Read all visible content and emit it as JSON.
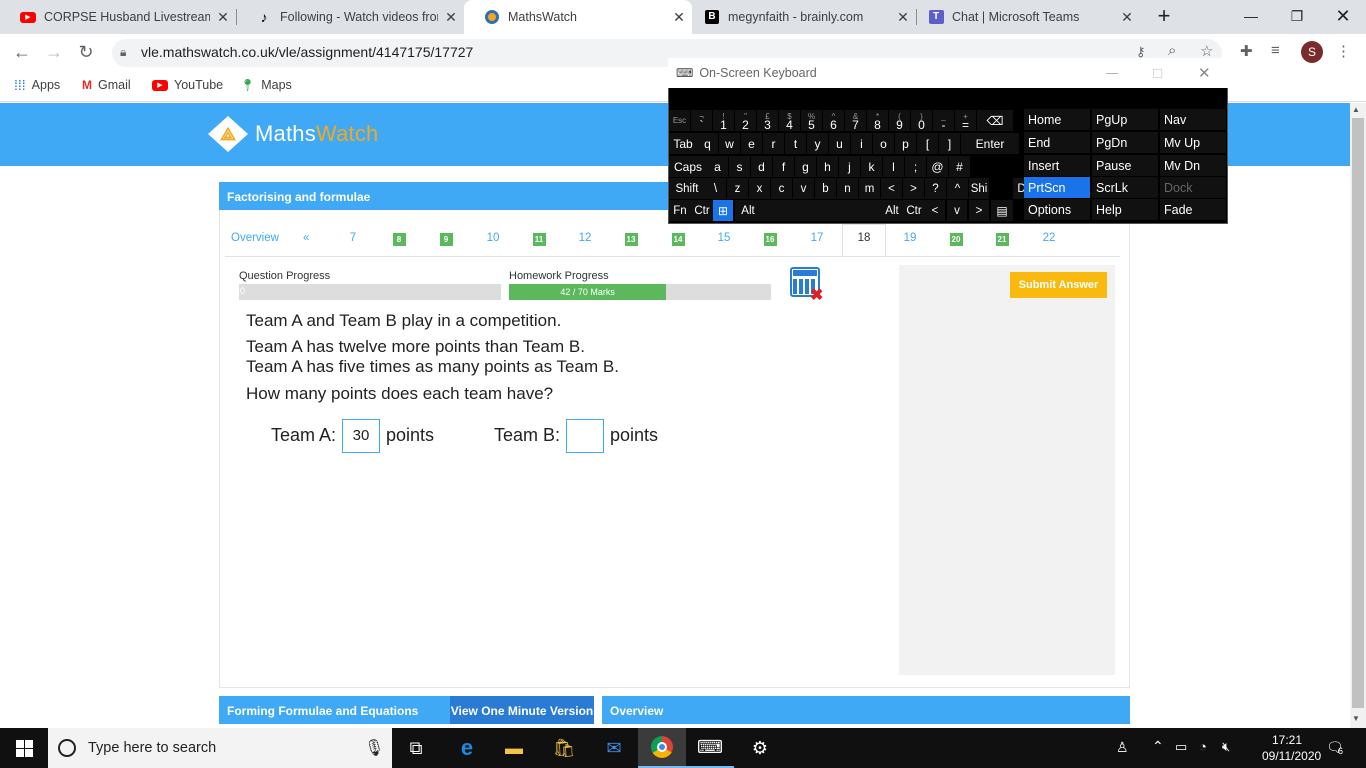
{
  "browser": {
    "tabs": [
      {
        "title": "CORPSE Husband Livestream |",
        "icon": "youtube-icon"
      },
      {
        "title": "Following - Watch videos from",
        "icon": "tiktok-icon"
      },
      {
        "title": "MathsWatch",
        "icon": "mathswatch-icon",
        "active": true
      },
      {
        "title": "megynfaith - brainly.com",
        "icon": "brainly-icon"
      },
      {
        "title": "Chat | Microsoft Teams",
        "icon": "teams-icon"
      }
    ],
    "url": "vle.mathswatch.co.uk/vle/assignment/4147175/17727",
    "profile_initial": "S",
    "bookmarks": [
      {
        "label": "Apps",
        "icon": "apps-grid-icon"
      },
      {
        "label": "Gmail",
        "icon": "gmail-icon"
      },
      {
        "label": "YouTube",
        "icon": "youtube-icon"
      },
      {
        "label": "Maps",
        "icon": "maps-pin-icon"
      }
    ]
  },
  "site": {
    "logo_text_a": "Maths",
    "logo_text_b": "Watch",
    "topic_title": "Factorising and formulae",
    "question_nav": {
      "overview": "Overview",
      "prev": "«",
      "items": [
        {
          "label": "7",
          "done": false
        },
        {
          "label": "8",
          "done": true
        },
        {
          "label": "9",
          "done": true
        },
        {
          "label": "10",
          "done": false
        },
        {
          "label": "11",
          "done": true
        },
        {
          "label": "12",
          "done": false
        },
        {
          "label": "13",
          "done": true
        },
        {
          "label": "14",
          "done": true
        },
        {
          "label": "15",
          "done": false
        },
        {
          "label": "16",
          "done": true
        },
        {
          "label": "17",
          "done": false
        },
        {
          "label": "18",
          "current": true
        },
        {
          "label": "19",
          "done": false
        },
        {
          "label": "20",
          "done": true
        },
        {
          "label": "21",
          "done": true
        },
        {
          "label": "22",
          "done": false
        }
      ]
    },
    "question_progress": {
      "label": "Question Progress",
      "value_text": "0",
      "fraction": 0
    },
    "homework_progress": {
      "label": "Homework Progress",
      "value_text": "42 / 70 Marks",
      "fraction": 0.6
    },
    "question": {
      "lines": [
        "Team A and Team B play in a competition.",
        "Team A has twelve more points than Team B.",
        "Team A has five times as many points as Team B.",
        "How many points does each team have?"
      ],
      "team_a_label": "Team A:",
      "team_a_value": "30",
      "team_b_label": "Team B:",
      "team_b_value": "",
      "unit": "points"
    },
    "submit_label": "Submit Answer",
    "footer": {
      "section_title": "Forming Formulae and Equations",
      "video_button": "View One Minute Version",
      "overview": "Overview"
    }
  },
  "osk": {
    "title": "On-Screen Keyboard",
    "row1": [
      {
        "top": "Esc",
        "main": ""
      },
      {
        "top": "¬",
        "main": "`"
      },
      {
        "top": "!",
        "main": "1"
      },
      {
        "top": "\"",
        "main": "2"
      },
      {
        "top": "£",
        "main": "3"
      },
      {
        "top": "$",
        "main": "4"
      },
      {
        "top": "%",
        "main": "5"
      },
      {
        "top": "^",
        "main": "6"
      },
      {
        "top": "&",
        "main": "7"
      },
      {
        "top": "*",
        "main": "8"
      },
      {
        "top": "(",
        "main": "9"
      },
      {
        "top": ")",
        "main": "0"
      },
      {
        "top": "_",
        "main": "-"
      },
      {
        "top": "+",
        "main": "="
      }
    ],
    "row2": [
      "Tab",
      "q",
      "w",
      "e",
      "r",
      "t",
      "y",
      "u",
      "i",
      "o",
      "p",
      "[",
      "]",
      "Enter"
    ],
    "row3": [
      "Caps",
      "a",
      "s",
      "d",
      "f",
      "g",
      "h",
      "j",
      "k",
      "l",
      ";",
      "@",
      "#"
    ],
    "row4": [
      "Shift",
      "\\",
      "z",
      "x",
      "c",
      "v",
      "b",
      "n",
      "m",
      "<",
      ">",
      "?",
      "^",
      "Shi",
      "Del"
    ],
    "row5": [
      "Fn",
      "Ctr",
      "Alt",
      "Alt",
      "Ctr",
      "<",
      "v",
      ">"
    ],
    "nav": [
      [
        "Home",
        "PgUp",
        "Nav"
      ],
      [
        "End",
        "PgDn",
        "Mv Up"
      ],
      [
        "Insert",
        "Pause",
        "Mv Dn"
      ],
      [
        "PrtScn",
        "ScrLk",
        "Dock"
      ],
      [
        "Options",
        "Help",
        "Fade"
      ]
    ]
  },
  "taskbar": {
    "search_placeholder": "Type here to search",
    "time": "17:21",
    "date": "09/11/2020",
    "notification_count": "6"
  }
}
